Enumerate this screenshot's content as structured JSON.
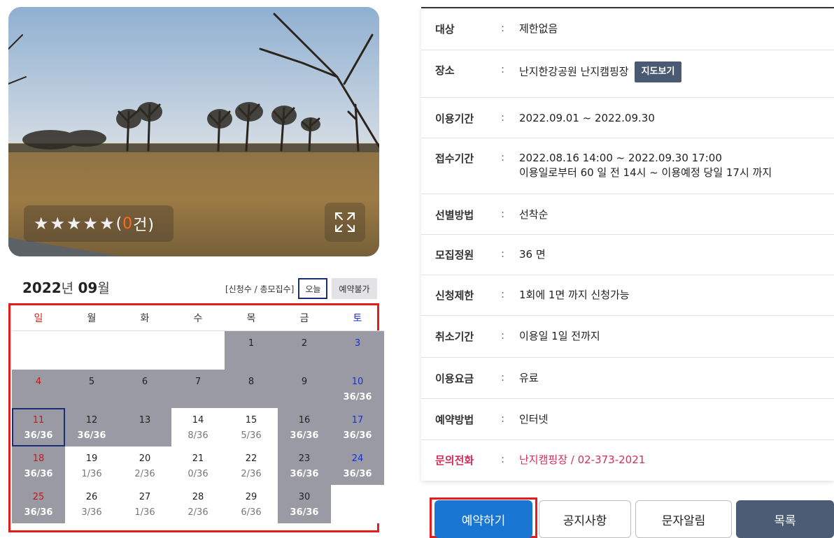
{
  "photo": {
    "rating": {
      "stars": "★★★★★",
      "open_paren": "(",
      "count": "0",
      "count_unit": "건)",
      "value": 0,
      "max": 5
    },
    "expand_icon": "expand-icon"
  },
  "calendar": {
    "year": "2022",
    "year_unit": "년",
    "month": "09",
    "month_unit": "월",
    "legend": {
      "applicants": "[신청수 / 총모집수]",
      "today": "오늘",
      "closed": "예약불가"
    },
    "weekdays": [
      "일",
      "월",
      "화",
      "수",
      "목",
      "금",
      "토"
    ],
    "weeks": [
      [
        {
          "day": "",
          "count": "",
          "full": false,
          "blank": true
        },
        {
          "day": "",
          "count": "",
          "full": false,
          "blank": true
        },
        {
          "day": "",
          "count": "",
          "full": false,
          "blank": true
        },
        {
          "day": "",
          "count": "",
          "full": false,
          "blank": true
        },
        {
          "day": "1",
          "count": "",
          "full": true
        },
        {
          "day": "2",
          "count": "",
          "full": true
        },
        {
          "day": "3",
          "count": "",
          "full": true
        }
      ],
      [
        {
          "day": "4",
          "count": "",
          "full": true
        },
        {
          "day": "5",
          "count": "",
          "full": true
        },
        {
          "day": "6",
          "count": "",
          "full": true
        },
        {
          "day": "7",
          "count": "",
          "full": true
        },
        {
          "day": "8",
          "count": "",
          "full": true
        },
        {
          "day": "9",
          "count": "",
          "full": true
        },
        {
          "day": "10",
          "count": "36/36",
          "full": true
        }
      ],
      [
        {
          "day": "11",
          "count": "36/36",
          "full": true,
          "today": true
        },
        {
          "day": "12",
          "count": "36/36",
          "full": true
        },
        {
          "day": "13",
          "count": "",
          "full": true
        },
        {
          "day": "14",
          "count": "8/36",
          "full": false
        },
        {
          "day": "15",
          "count": "5/36",
          "full": false
        },
        {
          "day": "16",
          "count": "36/36",
          "full": true
        },
        {
          "day": "17",
          "count": "36/36",
          "full": true
        }
      ],
      [
        {
          "day": "18",
          "count": "36/36",
          "full": true
        },
        {
          "day": "19",
          "count": "1/36",
          "full": false
        },
        {
          "day": "20",
          "count": "2/36",
          "full": false
        },
        {
          "day": "21",
          "count": "0/36",
          "full": false
        },
        {
          "day": "22",
          "count": "2/36",
          "full": false
        },
        {
          "day": "23",
          "count": "36/36",
          "full": true
        },
        {
          "day": "24",
          "count": "36/36",
          "full": true
        }
      ],
      [
        {
          "day": "25",
          "count": "36/36",
          "full": true
        },
        {
          "day": "26",
          "count": "3/36",
          "full": false
        },
        {
          "day": "27",
          "count": "1/36",
          "full": false
        },
        {
          "day": "28",
          "count": "2/36",
          "full": false
        },
        {
          "day": "29",
          "count": "6/36",
          "full": false
        },
        {
          "day": "30",
          "count": "36/36",
          "full": true
        },
        {
          "day": "",
          "count": "",
          "full": false,
          "blank": true
        }
      ]
    ]
  },
  "info": {
    "colon": ":",
    "target_label": "대상",
    "target_value": "제한없음",
    "place_label": "장소",
    "place_value": "난지한강공원 난지캠핑장",
    "map_button": "지도보기",
    "period_label": "이용기간",
    "period_value": "2022.09.01 ~ 2022.09.30",
    "reception_label": "접수기간",
    "reception_value": "2022.08.16 14:00 ~ 2022.09.30 17:00",
    "reception_note": "이용일로부터 60 일 전 14시 ~ 이용예정 당일 17시 까지",
    "selection_label": "선별방법",
    "selection_value": "선착순",
    "capacity_label": "모집정원",
    "capacity_value": "36 면",
    "limit_label": "신청제한",
    "limit_value": "1회에 1면 까지 신청가능",
    "cancel_label": "취소기간",
    "cancel_value": "이용일 1일 전까지",
    "fee_label": "이용요금",
    "fee_value": "유료",
    "method_label": "예약방법",
    "method_value": "인터넷",
    "phone_label": "문의전화",
    "phone_value": "난지캠핑장 / 02-373-2021"
  },
  "buttons": {
    "reserve": "예약하기",
    "notice": "공지사항",
    "sms": "문자알림",
    "list": "목록"
  },
  "colors": {
    "primary": "#1976d2",
    "dark_button": "#4b5d75",
    "highlight_frame": "#e51c1c",
    "phone": "#d62c58",
    "full_cell": "#9a9aa4"
  }
}
